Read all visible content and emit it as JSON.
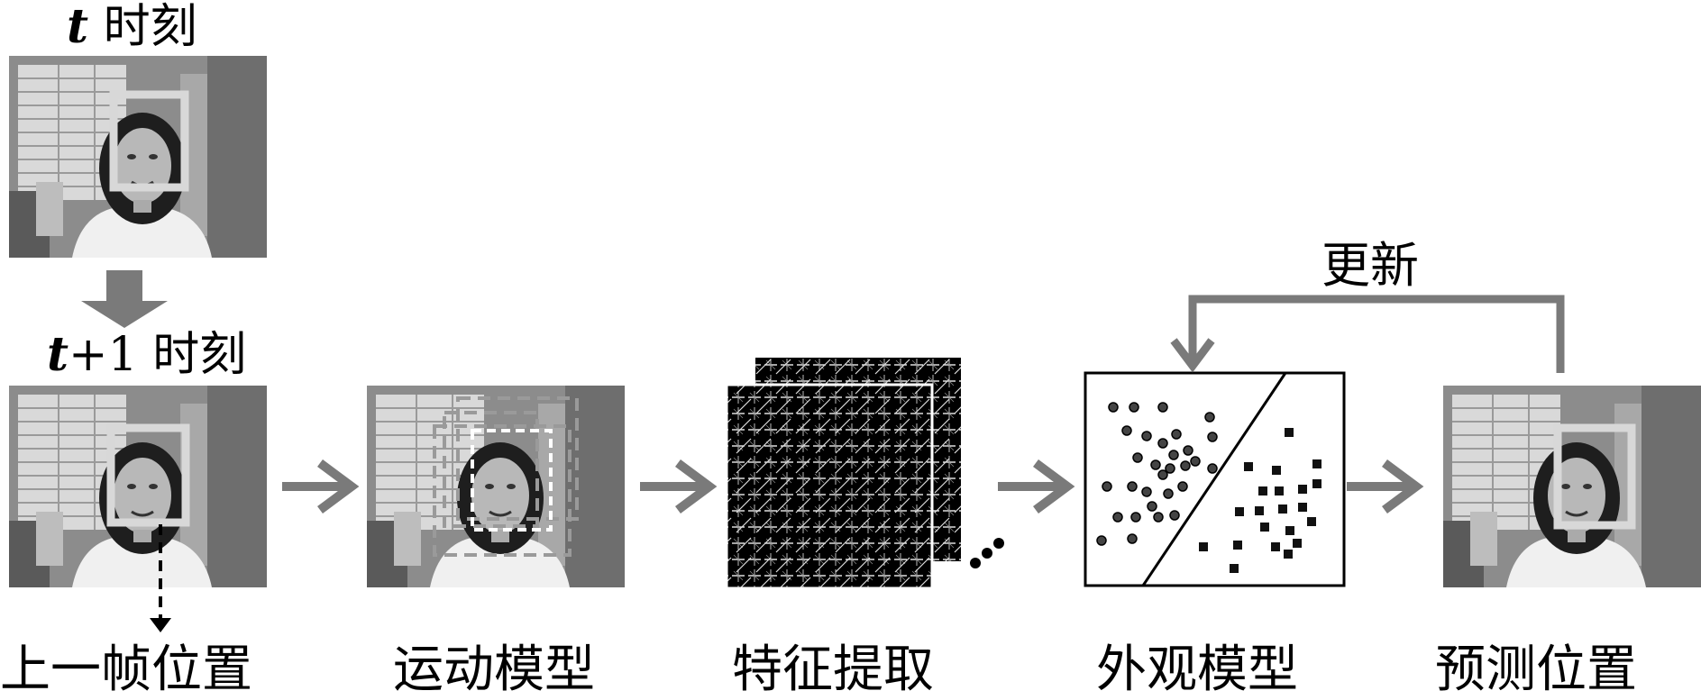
{
  "top_caption": {
    "var": "t",
    "suffix": "时刻"
  },
  "second_caption": {
    "var": "t",
    "plus": "+1",
    "suffix": "时刻"
  },
  "update_label": "更新",
  "stage_labels": [
    "上一帧位置",
    "运动模型",
    "特征提取",
    "外观模型",
    "预测位置"
  ],
  "ellipsis": "…",
  "colors": {
    "arrow": "#7a7a7a",
    "box_face": "#d8d8d8",
    "text": "#000000"
  },
  "icons": [
    "frame-image-icon",
    "down-arrow-icon",
    "right-arrow-icon",
    "hog-feature-map-icon",
    "classifier-plot-icon"
  ]
}
